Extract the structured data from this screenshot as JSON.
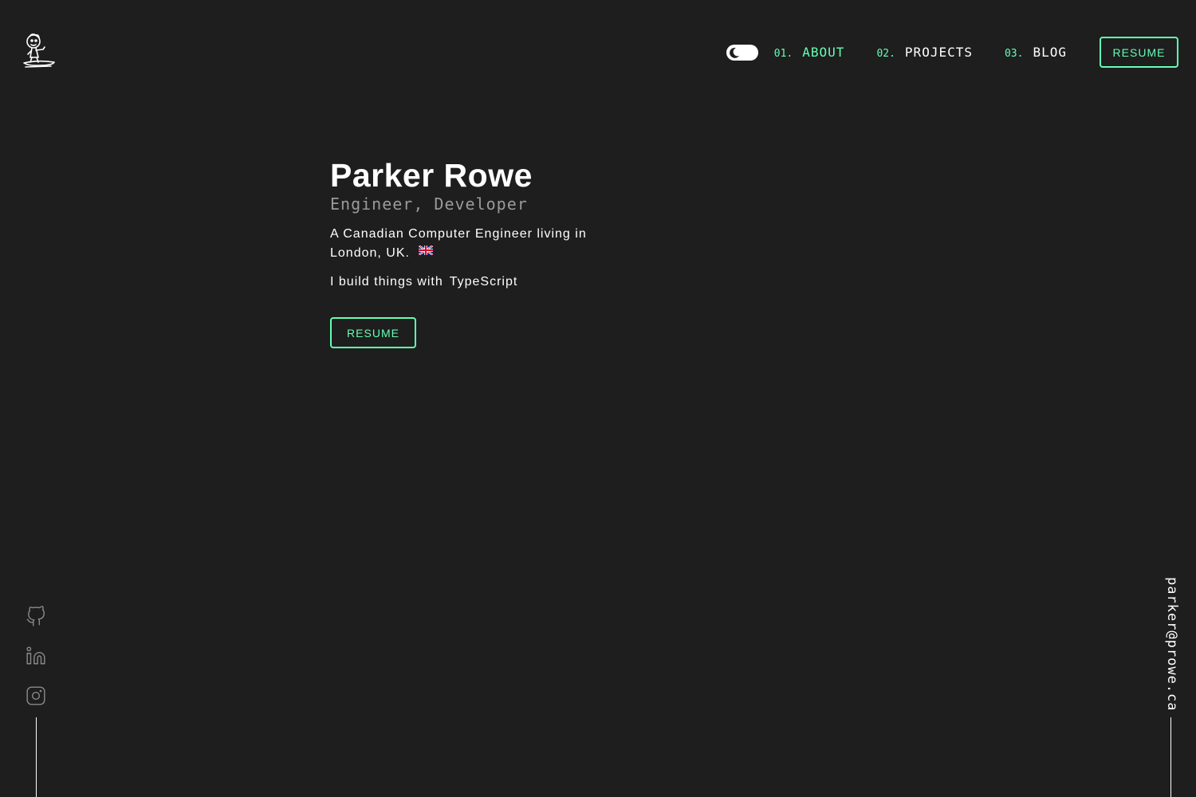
{
  "colors": {
    "background": "#1e1e1e",
    "accent": "#64ffb4",
    "text": "#ffffff",
    "muted": "#9a9a9a"
  },
  "header": {
    "logo_icon": "sketch-character-logo-icon",
    "theme_toggle_icon": "moon-icon",
    "nav": [
      {
        "num": "01.",
        "label": "ABOUT",
        "active": true
      },
      {
        "num": "02.",
        "label": "PROJECTS",
        "active": false
      },
      {
        "num": "03.",
        "label": "BLOG",
        "active": false
      }
    ],
    "resume_label": "RESUME"
  },
  "hero": {
    "name": "Parker Rowe",
    "role": "Engineer, Developer",
    "intro": "A Canadian Computer Engineer living in London, UK.",
    "flag_icon": "uk-flag-icon",
    "build_prefix": "I build things with",
    "build_tech": "TypeScript",
    "resume_label": "RESUME"
  },
  "socials": [
    {
      "icon": "github-icon"
    },
    {
      "icon": "linkedin-icon"
    },
    {
      "icon": "instagram-icon"
    }
  ],
  "email": "parker@prowe.ca"
}
